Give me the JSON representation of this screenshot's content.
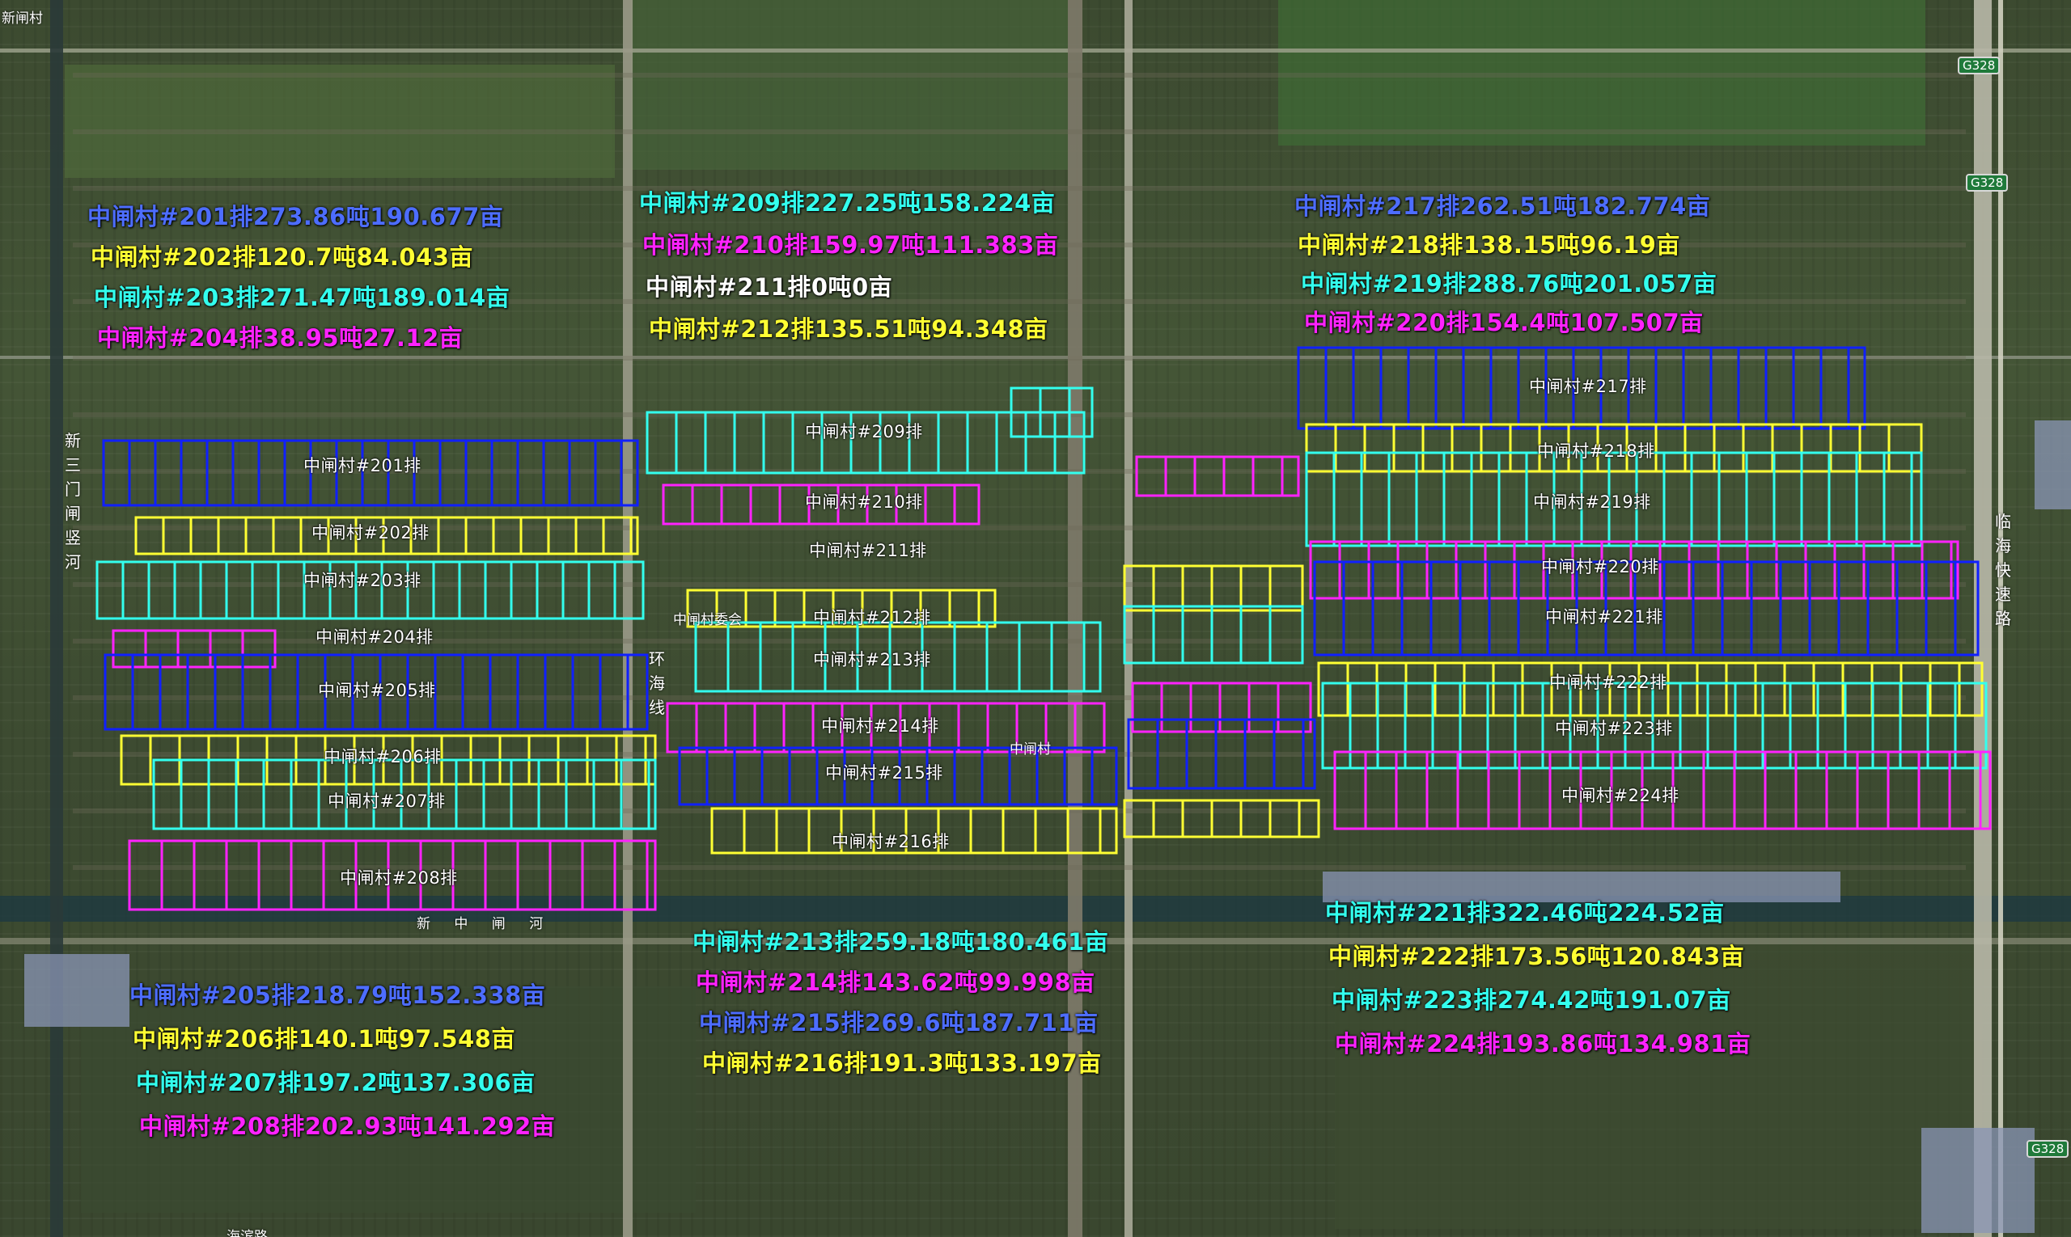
{
  "map": {
    "top_left_label": "新闸村",
    "road_shields": [
      "G328",
      "G328",
      "G328"
    ],
    "vertical_labels": {
      "left_river": "新三门闸竖河",
      "highway": "临海快速路",
      "rail": "环海线"
    },
    "canal_label": "新 中 闸 河",
    "place_labels": [
      "中闸村委会",
      "中闸村"
    ],
    "bottom_road": "海滨路",
    "colors": {
      "blue_text": "#4d6dff",
      "yellow": "#ffff33",
      "cyan": "#33ffee",
      "magenta": "#ff22ff",
      "white": "#ffffff",
      "blue_outline": "#1020ff"
    }
  },
  "groups": [
    {
      "lines": [
        {
          "text": "中闸村#201排273.86吨190.677亩",
          "color": "blue"
        },
        {
          "text": "中闸村#202排120.7吨84.043亩",
          "color": "yellow"
        },
        {
          "text": "中闸村#203排271.47吨189.014亩",
          "color": "cyan"
        },
        {
          "text": "中闸村#204排38.95吨27.12亩",
          "color": "magenta"
        }
      ]
    },
    {
      "lines": [
        {
          "text": "中闸村#209排227.25吨158.224亩",
          "color": "cyan"
        },
        {
          "text": "中闸村#210排159.97吨111.383亩",
          "color": "magenta"
        },
        {
          "text": "中闸村#211排0吨0亩",
          "color": "white"
        },
        {
          "text": "中闸村#212排135.51吨94.348亩",
          "color": "yellow"
        }
      ]
    },
    {
      "lines": [
        {
          "text": "中闸村#217排262.51吨182.774亩",
          "color": "blue"
        },
        {
          "text": "中闸村#218排138.15吨96.19亩",
          "color": "yellow"
        },
        {
          "text": "中闸村#219排288.76吨201.057亩",
          "color": "cyan"
        },
        {
          "text": "中闸村#220排154.4吨107.507亩",
          "color": "magenta"
        }
      ]
    },
    {
      "lines": [
        {
          "text": "中闸村#221排322.46吨224.52亩",
          "color": "cyan"
        },
        {
          "text": "中闸村#222排173.56吨120.843亩",
          "color": "yellow"
        },
        {
          "text": "中闸村#223排274.42吨191.07亩",
          "color": "cyan"
        },
        {
          "text": "中闸村#224排193.86吨134.981亩",
          "color": "magenta"
        }
      ]
    },
    {
      "lines": [
        {
          "text": "中闸村#213排259.18吨180.461亩",
          "color": "cyan"
        },
        {
          "text": "中闸村#214排143.62吨99.998亩",
          "color": "magenta"
        },
        {
          "text": "中闸村#215排269.6吨187.711亩",
          "color": "blue"
        },
        {
          "text": "中闸村#216排191.3吨133.197亩",
          "color": "yellow"
        }
      ]
    },
    {
      "lines": [
        {
          "text": "中闸村#205排218.79吨152.338亩",
          "color": "blue"
        },
        {
          "text": "中闸村#206排140.1吨97.548亩",
          "color": "yellow"
        },
        {
          "text": "中闸村#207排197.2吨137.306亩",
          "color": "cyan"
        },
        {
          "text": "中闸村#208排202.93吨141.292亩",
          "color": "magenta"
        }
      ]
    }
  ],
  "rows": [
    {
      "label": "中闸村#201排",
      "color": "blue"
    },
    {
      "label": "中闸村#202排",
      "color": "yellow"
    },
    {
      "label": "中闸村#203排",
      "color": "cyan"
    },
    {
      "label": "中闸村#204排",
      "color": "magenta"
    },
    {
      "label": "中闸村#205排",
      "color": "blue"
    },
    {
      "label": "中闸村#206排",
      "color": "yellow"
    },
    {
      "label": "中闸村#207排",
      "color": "cyan"
    },
    {
      "label": "中闸村#208排",
      "color": "magenta"
    },
    {
      "label": "中闸村#209排",
      "color": "cyan"
    },
    {
      "label": "中闸村#210排",
      "color": "magenta"
    },
    {
      "label": "中闸村#211排",
      "color": "white"
    },
    {
      "label": "中闸村#212排",
      "color": "yellow"
    },
    {
      "label": "中闸村#213排",
      "color": "cyan"
    },
    {
      "label": "中闸村#214排",
      "color": "magenta"
    },
    {
      "label": "中闸村#215排",
      "color": "blue"
    },
    {
      "label": "中闸村#216排",
      "color": "yellow"
    },
    {
      "label": "中闸村#217排",
      "color": "blue"
    },
    {
      "label": "中闸村#218排",
      "color": "yellow"
    },
    {
      "label": "中闸村#219排",
      "color": "cyan"
    },
    {
      "label": "中闸村#220排",
      "color": "magenta"
    },
    {
      "label": "中闸村#221排",
      "color": "blue"
    },
    {
      "label": "中闸村#222排",
      "color": "yellow"
    },
    {
      "label": "中闸村#223排",
      "color": "cyan"
    },
    {
      "label": "中闸村#224排",
      "color": "magenta"
    }
  ]
}
